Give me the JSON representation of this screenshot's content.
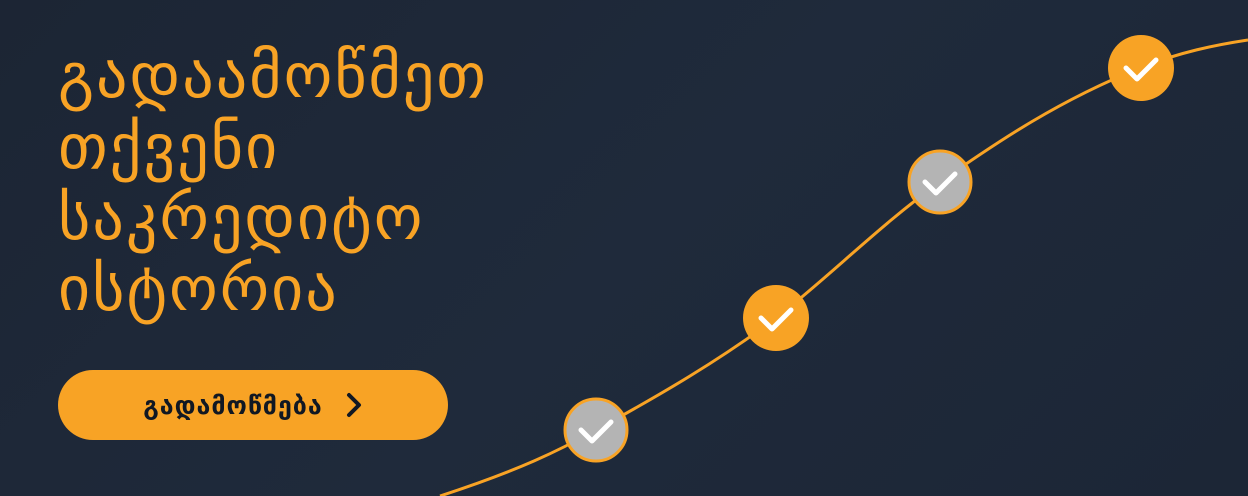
{
  "headline": {
    "lines": [
      "გადაამოწმეთ",
      "თქვენი",
      "საკრედიტო",
      "ისტორია"
    ]
  },
  "cta": {
    "label": "გადამოწმება",
    "icon": "chevron-right-icon"
  },
  "checkpoints": [
    {
      "icon": "check-icon",
      "state": "inactive"
    },
    {
      "icon": "check-icon",
      "state": "active"
    },
    {
      "icon": "check-icon",
      "state": "inactive"
    },
    {
      "icon": "check-icon",
      "state": "active"
    }
  ],
  "colors": {
    "background": "#1c2534",
    "accent": "#f8a325",
    "inactive": "#b4b4b4",
    "button_text": "#111823"
  }
}
